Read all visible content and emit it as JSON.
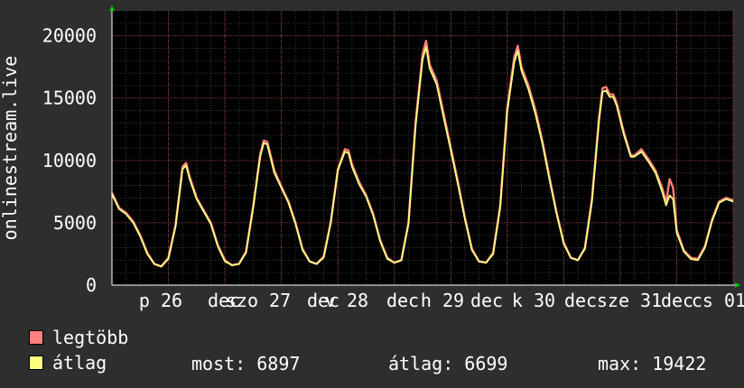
{
  "chart_data": {
    "type": "line",
    "ylabel": "onlinestream.live",
    "ylim": [
      0,
      22000
    ],
    "yticks": [
      0,
      5000,
      10000,
      15000,
      20000
    ],
    "grid": true,
    "x_tick_labels": [
      "p 26",
      "dec",
      "szo 27",
      "dec",
      "v 28",
      "dec",
      "h 29",
      "dec",
      "k 30",
      "dec",
      "sze 31",
      "dec",
      "cs 01"
    ],
    "series": [
      {
        "name": "legtöbb",
        "color": "#ff7f7f",
        "points": [
          [
            0,
            7400
          ],
          [
            2,
            6200
          ],
          [
            4,
            5800
          ],
          [
            6,
            5100
          ],
          [
            8,
            4000
          ],
          [
            10,
            2600
          ],
          [
            12,
            1700
          ],
          [
            14,
            1500
          ],
          [
            16,
            2200
          ],
          [
            18,
            4800
          ],
          [
            20,
            9500
          ],
          [
            21,
            9800
          ],
          [
            22,
            8700
          ],
          [
            24,
            7000
          ],
          [
            26,
            6000
          ],
          [
            28,
            5000
          ],
          [
            30,
            3200
          ],
          [
            32,
            2000
          ],
          [
            34,
            1600
          ],
          [
            36,
            1700
          ],
          [
            38,
            2700
          ],
          [
            40,
            6300
          ],
          [
            42,
            10500
          ],
          [
            43,
            11600
          ],
          [
            44,
            11500
          ],
          [
            46,
            9200
          ],
          [
            48,
            7900
          ],
          [
            50,
            6700
          ],
          [
            52,
            5000
          ],
          [
            54,
            2900
          ],
          [
            56,
            1900
          ],
          [
            58,
            1700
          ],
          [
            60,
            2300
          ],
          [
            62,
            5100
          ],
          [
            64,
            9300
          ],
          [
            66,
            10900
          ],
          [
            67,
            10800
          ],
          [
            68,
            9700
          ],
          [
            70,
            8300
          ],
          [
            72,
            7200
          ],
          [
            74,
            5700
          ],
          [
            76,
            3600
          ],
          [
            78,
            2200
          ],
          [
            80,
            1800
          ],
          [
            82,
            2000
          ],
          [
            84,
            5000
          ],
          [
            86,
            13000
          ],
          [
            88,
            18500
          ],
          [
            89,
            19600
          ],
          [
            90,
            17700
          ],
          [
            92,
            16400
          ],
          [
            94,
            13700
          ],
          [
            96,
            11000
          ],
          [
            98,
            8300
          ],
          [
            100,
            5400
          ],
          [
            102,
            2900
          ],
          [
            104,
            1900
          ],
          [
            106,
            1800
          ],
          [
            108,
            2600
          ],
          [
            110,
            6400
          ],
          [
            112,
            14200
          ],
          [
            114,
            18300
          ],
          [
            115,
            19200
          ],
          [
            116,
            17500
          ],
          [
            118,
            16000
          ],
          [
            120,
            14000
          ],
          [
            122,
            11500
          ],
          [
            124,
            8600
          ],
          [
            126,
            5800
          ],
          [
            128,
            3400
          ],
          [
            130,
            2200
          ],
          [
            132,
            2000
          ],
          [
            134,
            3000
          ],
          [
            136,
            6900
          ],
          [
            138,
            13500
          ],
          [
            139,
            15800
          ],
          [
            140,
            15900
          ],
          [
            141,
            15300
          ],
          [
            142,
            15300
          ],
          [
            143,
            14600
          ],
          [
            145,
            12300
          ],
          [
            147,
            10400
          ],
          [
            148,
            10400
          ],
          [
            150,
            10900
          ],
          [
            152,
            10100
          ],
          [
            154,
            9200
          ],
          [
            156,
            7700
          ],
          [
            157,
            6600
          ],
          [
            158,
            8500
          ],
          [
            159,
            7800
          ],
          [
            160,
            4400
          ],
          [
            162,
            2800
          ],
          [
            164,
            2200
          ],
          [
            166,
            2100
          ],
          [
            168,
            3100
          ],
          [
            170,
            5200
          ],
          [
            172,
            6700
          ],
          [
            174,
            7000
          ],
          [
            176,
            6800
          ]
        ]
      },
      {
        "name": "átlag",
        "color": "#ffff7f",
        "points": [
          [
            0,
            7300
          ],
          [
            2,
            6100
          ],
          [
            4,
            5700
          ],
          [
            6,
            5000
          ],
          [
            8,
            3900
          ],
          [
            10,
            2500
          ],
          [
            12,
            1700
          ],
          [
            14,
            1500
          ],
          [
            16,
            2100
          ],
          [
            18,
            4700
          ],
          [
            20,
            9300
          ],
          [
            21,
            9600
          ],
          [
            22,
            8500
          ],
          [
            24,
            6900
          ],
          [
            26,
            5900
          ],
          [
            28,
            4900
          ],
          [
            30,
            3100
          ],
          [
            32,
            1900
          ],
          [
            34,
            1600
          ],
          [
            36,
            1700
          ],
          [
            38,
            2600
          ],
          [
            40,
            6200
          ],
          [
            42,
            10300
          ],
          [
            43,
            11400
          ],
          [
            44,
            11300
          ],
          [
            46,
            9000
          ],
          [
            48,
            7800
          ],
          [
            50,
            6600
          ],
          [
            52,
            4900
          ],
          [
            54,
            2800
          ],
          [
            56,
            1900
          ],
          [
            58,
            1700
          ],
          [
            60,
            2200
          ],
          [
            62,
            5000
          ],
          [
            64,
            9200
          ],
          [
            66,
            10700
          ],
          [
            67,
            10600
          ],
          [
            68,
            9500
          ],
          [
            70,
            8100
          ],
          [
            72,
            7100
          ],
          [
            74,
            5600
          ],
          [
            76,
            3500
          ],
          [
            78,
            2100
          ],
          [
            80,
            1800
          ],
          [
            82,
            2000
          ],
          [
            84,
            4900
          ],
          [
            86,
            12700
          ],
          [
            88,
            18100
          ],
          [
            89,
            19100
          ],
          [
            90,
            17400
          ],
          [
            92,
            16100
          ],
          [
            94,
            13400
          ],
          [
            96,
            10800
          ],
          [
            98,
            8100
          ],
          [
            100,
            5300
          ],
          [
            102,
            2800
          ],
          [
            104,
            1900
          ],
          [
            106,
            1800
          ],
          [
            108,
            2500
          ],
          [
            110,
            6200
          ],
          [
            112,
            13900
          ],
          [
            114,
            17900
          ],
          [
            115,
            18800
          ],
          [
            116,
            17200
          ],
          [
            118,
            15700
          ],
          [
            120,
            13700
          ],
          [
            122,
            11300
          ],
          [
            124,
            8400
          ],
          [
            126,
            5700
          ],
          [
            128,
            3300
          ],
          [
            130,
            2200
          ],
          [
            132,
            2000
          ],
          [
            134,
            2900
          ],
          [
            136,
            6700
          ],
          [
            138,
            13200
          ],
          [
            139,
            15500
          ],
          [
            140,
            15600
          ],
          [
            141,
            15100
          ],
          [
            142,
            15100
          ],
          [
            143,
            14400
          ],
          [
            145,
            12100
          ],
          [
            147,
            10300
          ],
          [
            148,
            10300
          ],
          [
            150,
            10700
          ],
          [
            152,
            9900
          ],
          [
            154,
            9000
          ],
          [
            156,
            7400
          ],
          [
            157,
            6400
          ],
          [
            158,
            7200
          ],
          [
            159,
            6900
          ],
          [
            160,
            4200
          ],
          [
            162,
            2700
          ],
          [
            164,
            2100
          ],
          [
            166,
            2000
          ],
          [
            168,
            3000
          ],
          [
            170,
            5100
          ],
          [
            172,
            6600
          ],
          [
            174,
            6900
          ],
          [
            176,
            6700
          ]
        ]
      }
    ]
  },
  "legend": {
    "max_label": "legtöbb",
    "avg_label": "átlag"
  },
  "stats": {
    "current": "most: 6897",
    "average": "átlag: 6699",
    "maximum": "max: 19422"
  }
}
